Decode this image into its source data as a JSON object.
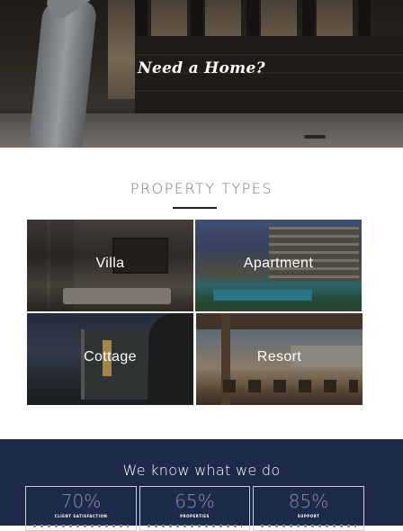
{
  "hero": {
    "title": "Need a Home?"
  },
  "property_section": {
    "title": "PROPERTY TYPES",
    "types": [
      {
        "label": "Villa"
      },
      {
        "label": "Apartment"
      },
      {
        "label": "Cottage"
      },
      {
        "label": "Resort"
      }
    ]
  },
  "stats_section": {
    "title": "We know what we do",
    "stats": [
      {
        "value": "70%",
        "label": "CLIENT SATISFACTION"
      },
      {
        "value": "65%",
        "label": "PROPERTIES"
      },
      {
        "value": "85%",
        "label": "SUPPORT"
      }
    ]
  },
  "colors": {
    "stats_background": "#1e2a4a",
    "stat_value": "#8891ad",
    "title_rule": "#222222"
  }
}
